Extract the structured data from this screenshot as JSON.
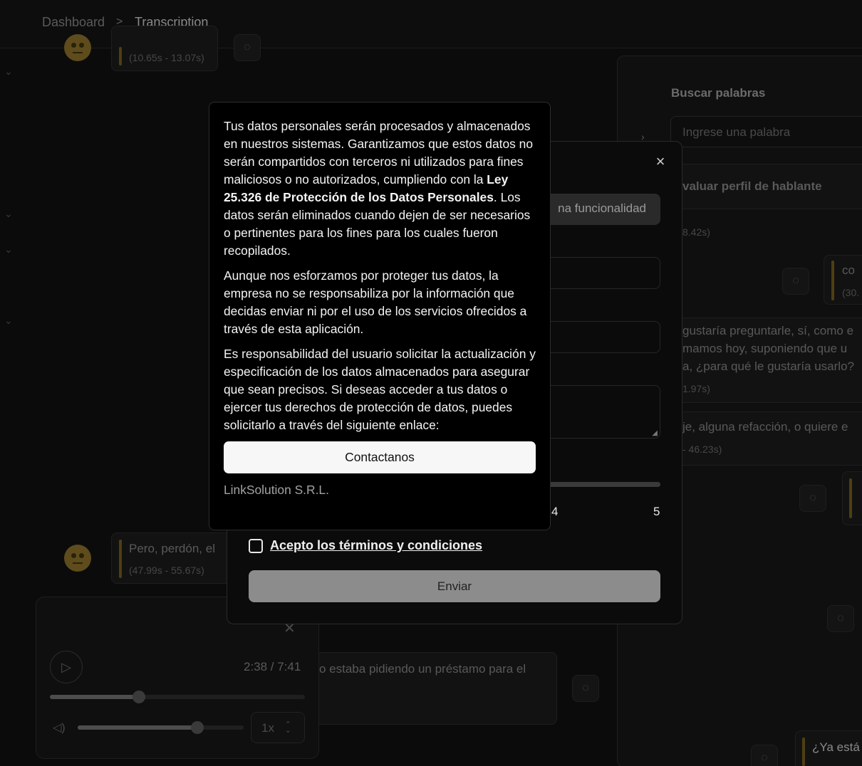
{
  "breadcrumb": {
    "home": "Dashboard",
    "separator": ">",
    "current": "Transcription"
  },
  "search_panel": {
    "title": "Buscar palabras",
    "placeholder": "Ingrese una palabra",
    "evaluate_label": "valuar perfil de hablante"
  },
  "transcript": {
    "seg1_time": "(10.65s - 13.07s)",
    "r_time_a": "8.42s)",
    "r_text_b": "co",
    "r_time_b": "(30.",
    "r_text_c1": "gustaría preguntarle, sí, como e",
    "r_text_c2": "mamos hoy, suponiendo que u",
    "r_text_c3": "a, ¿para qué le gustaría usarlo?",
    "r_time_c": "1.97s)",
    "r_text_d": "je, alguna refacción, o quiere e",
    "r_time_d": "- 46.23s)",
    "seg2_text": "Pero, perdón, el",
    "seg2_time": "(47.99s - 55.67s)",
    "seg3_text": "o estaba pidiendo un préstamo para el",
    "seg4_text": "¿Ya está"
  },
  "player": {
    "time": "2:38 / 7:41",
    "speed": "1x",
    "progress": 0.35,
    "volume": 0.72
  },
  "form_dialog": {
    "close_icon": "×",
    "function_button": "na funcionalidad",
    "slider_label_4": "4",
    "slider_label_5": "5",
    "terms": "Acepto los términos y condiciones",
    "submit": "Enviar"
  },
  "privacy": {
    "p1_a": "Tus datos personales serán procesados y almacenados en nuestros sistemas. Garantizamos que estos datos no serán compartidos con terceros ni utilizados para fines maliciosos o no autorizados, cumpliendo con la ",
    "p1_bold": "Ley 25.326 de Protección de los Datos Personales",
    "p1_b": ". Los datos serán eliminados cuando dejen de ser necesarios o pertinentes para los fines para los cuales fueron recopilados.",
    "p2": "Aunque nos esforzamos por proteger tus datos, la empresa no se responsabiliza por la información que decidas enviar ni por el uso de los servicios ofrecidos a través de esta aplicación.",
    "p3": "Es responsabilidad del usuario solicitar la actualización y especificación de los datos almacenados para asegurar que sean precisos. Si deseas acceder a tus datos o ejercer tus derechos de protección de datos, puedes solicitarlo a través del siguiente enlace:",
    "contact_button": "Contactanos",
    "company": "LinkSolution S.R.L."
  },
  "colors": {
    "accent_bar": "#4e3f12",
    "overlay": "#000000",
    "submit_disabled": "#8c8c8c"
  }
}
